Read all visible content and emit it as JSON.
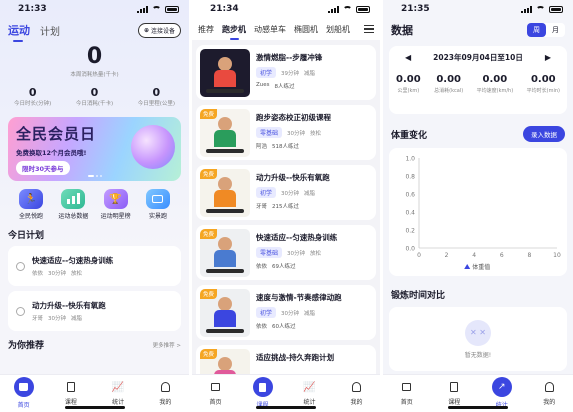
{
  "status": {
    "s1_time": "21:33",
    "s2_time": "21:34",
    "s3_time": "21:35"
  },
  "home": {
    "tabs": [
      "运动",
      "计划"
    ],
    "connect_device": "连接设备",
    "total_calories": "0",
    "total_calories_label": "本周消耗热量(千卡)",
    "stats": [
      {
        "value": "0",
        "label": "今日时长(分钟)"
      },
      {
        "value": "0",
        "label": "今日消耗(千卡)"
      },
      {
        "value": "0",
        "label": "今日里程(公里)"
      }
    ],
    "banner": {
      "title": "全民会员日",
      "subtitle": "免费换取12个月会员哦!",
      "button": "限时30天参与"
    },
    "shortcuts": [
      {
        "label": "全民悦跑",
        "icon": "runner-icon"
      },
      {
        "label": "运动总数据",
        "icon": "bar-chart-icon"
      },
      {
        "label": "运动明星榜",
        "icon": "trophy-icon"
      },
      {
        "label": "实景跑",
        "icon": "tv-icon"
      }
    ],
    "plan_title": "今日计划",
    "plans": [
      {
        "title": "快速适应--匀速热身训练",
        "coach": "依依",
        "duration": "30分钟",
        "goal": "放松"
      },
      {
        "title": "动力升级--快乐有氧跑",
        "coach": "牙哥",
        "duration": "30分钟",
        "goal": "减脂"
      }
    ],
    "recommend_title": "为你推荐",
    "recommend_more": "更多推荐 >"
  },
  "courses": {
    "categories": [
      "推荐",
      "跑步机",
      "动感单车",
      "椭圆机",
      "划船机"
    ],
    "items": [
      {
        "title": "激情燃脂--步履冲锋",
        "level": "初学",
        "duration": "39分钟",
        "goal": "减脂",
        "coach": "Zues",
        "count": "8人练过",
        "badge": "",
        "bg": "#1d1b2d"
      },
      {
        "title": "跑步姿态校正初级课程",
        "level": "零基础",
        "duration": "30分钟",
        "goal": "技松",
        "coach": "阿浩",
        "count": "518人练过",
        "badge": "免费",
        "bg": "#f6f4ef"
      },
      {
        "title": "动力升级--快乐有氧跑",
        "level": "初学",
        "duration": "30分钟",
        "goal": "减脂",
        "coach": "牙哥",
        "count": "215人练过",
        "badge": "免费",
        "bg": "#f5f3ec"
      },
      {
        "title": "快速适应--匀速热身训练",
        "level": "零基础",
        "duration": "30分钟",
        "goal": "放松",
        "coach": "依依",
        "count": "69人练过",
        "badge": "免费",
        "bg": "#eef0f2"
      },
      {
        "title": "速度与激情-节奏感律动跑",
        "level": "初学",
        "duration": "30分钟",
        "goal": "减脂",
        "coach": "依依",
        "count": "60人练过",
        "badge": "免费",
        "bg": "#eef0f2"
      },
      {
        "title": "适应挑战-持久奔跑计划",
        "level": "",
        "duration": "",
        "goal": "",
        "coach": "",
        "count": "",
        "badge": "免费",
        "bg": "#f5f3ec"
      }
    ]
  },
  "data": {
    "title": "数据",
    "period": [
      "周",
      "月"
    ],
    "date_range": "2023年09月04日至10日",
    "metrics": [
      {
        "value": "0.00",
        "label": "公里(km)"
      },
      {
        "value": "0.00",
        "label": "总消耗(kcal)"
      },
      {
        "value": "0.00",
        "label": "平均速度(km/h)"
      },
      {
        "value": "0.00",
        "label": "平均时长(min)"
      }
    ],
    "weight_title": "体重变化",
    "weight_button": "录入数据",
    "legend": "体重值",
    "compare_title": "锻炼时间对比",
    "empty_text": "暂无数据!"
  },
  "chart_data": {
    "type": "line",
    "title": "体重变化",
    "x": [
      0,
      2,
      4,
      6,
      8,
      10
    ],
    "y_ticks": [
      0.0,
      0.2,
      0.4,
      0.6,
      0.8,
      1.0
    ],
    "xlim": [
      0,
      10
    ],
    "ylim": [
      0,
      1.0
    ],
    "series": [
      {
        "name": "体重值",
        "values": []
      }
    ],
    "legend": "bottom-center"
  },
  "tabbar": [
    "首页",
    "课程",
    "统计",
    "我的"
  ],
  "colors": {
    "accent": "#3b46e0",
    "badge": "#f5a623",
    "tag": "#e8eaff"
  }
}
